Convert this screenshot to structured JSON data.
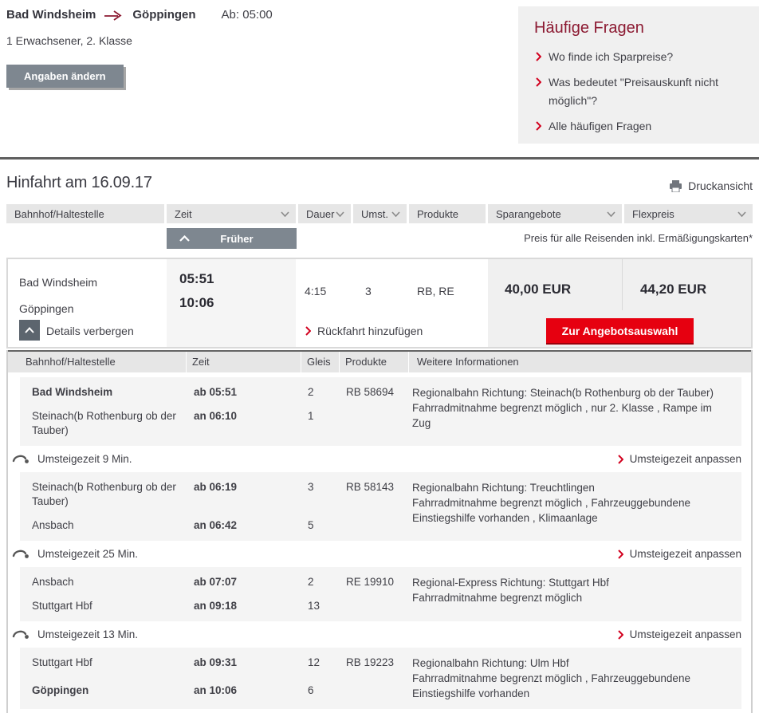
{
  "trip_header": {
    "from": "Bad Windsheim",
    "to": "Göppingen",
    "departure": "Ab: 05:00",
    "passengers": "1 Erwachsener, 2. Klasse",
    "change_button": "Angaben ändern"
  },
  "faq": {
    "title": "Häufige Fragen",
    "items": [
      {
        "label": "Wo finde ich Sparpreise?"
      },
      {
        "label": "Was bedeutet \"Preisauskunft nicht möglich\"?"
      },
      {
        "label": "Alle häufigen Fragen"
      }
    ]
  },
  "results": {
    "title": "Hinfahrt am 16.09.17",
    "print_label": "Druckansicht",
    "filters": [
      {
        "label": "Bahnhof/Haltestelle"
      },
      {
        "label": "Zeit"
      },
      {
        "label": "Dauer"
      },
      {
        "label": "Umst."
      },
      {
        "label": "Produkte"
      },
      {
        "label": "Sparangebote"
      },
      {
        "label": "Flexpreis"
      }
    ],
    "earlier_button": "Früher",
    "price_note": "Preis für alle Reisenden inkl. Ermäßigungskarten*",
    "connection": {
      "from": "Bad Windsheim",
      "to": "Göppingen",
      "departure_time": "05:51",
      "arrival_time": "10:06",
      "duration": "4:15",
      "changes": "3",
      "products": "RB, RE",
      "saver_price": "40,00 EUR",
      "flex_price": "44,20 EUR",
      "details_toggle": "Details verbergen",
      "return_link": "Rückfahrt hinzufügen",
      "offer_button": "Zur Angebotsauswahl"
    }
  },
  "details": {
    "columns": {
      "station": "Bahnhof/Haltestelle",
      "time": "Zeit",
      "platform": "Gleis",
      "products": "Produkte",
      "info": "Weitere Informationen"
    },
    "legs": [
      {
        "from": "Bad Windsheim",
        "dep": "ab 05:51",
        "dep_platform": "2",
        "to": "Steinach(b Rothenburg ob der Tauber)",
        "arr": "an 06:10",
        "arr_platform": "1",
        "train": "RB 58694",
        "direction": "Regionalbahn Richtung: Steinach(b Rothenburg ob der Tauber)",
        "amenities": "Fahrradmitnahme begrenzt möglich , nur 2. Klasse , Rampe im Zug"
      },
      {
        "from": "Steinach(b Rothenburg ob der Tauber)",
        "dep": "ab 06:19",
        "dep_platform": "3",
        "to": "Ansbach",
        "arr": "an 06:42",
        "arr_platform": "5",
        "train": "RB 58143",
        "direction": "Regionalbahn Richtung: Treuchtlingen",
        "amenities": "Fahrradmitnahme begrenzt möglich , Fahrzeuggebundene Einstiegshilfe vorhanden , Klimaanlage"
      },
      {
        "from": "Ansbach",
        "dep": "ab 07:07",
        "dep_platform": "2",
        "to": "Stuttgart Hbf",
        "arr": "an 09:18",
        "arr_platform": "13",
        "train": "RE 19910",
        "direction": "Regional-Express Richtung: Stuttgart Hbf",
        "amenities": "Fahrradmitnahme begrenzt möglich"
      },
      {
        "from": "Stuttgart Hbf",
        "dep": "ab 09:31",
        "dep_platform": "12",
        "to": "Göppingen",
        "arr": "an 10:06",
        "arr_platform": "6",
        "train": "RB 19223",
        "direction": "Regionalbahn Richtung: Ulm Hbf",
        "amenities": "Fahrradmitnahme begrenzt möglich , Fahrzeuggebundene Einstiegshilfe vorhanden"
      }
    ],
    "transfers": [
      {
        "label": "Umsteigezeit 9 Min.",
        "link": "Umsteigezeit anpassen"
      },
      {
        "label": "Umsteigezeit 25 Min.",
        "link": "Umsteigezeit anpassen"
      },
      {
        "label": "Umsteigezeit 13 Min.",
        "link": "Umsteigezeit anpassen"
      }
    ]
  },
  "colors": {
    "db_red": "#e60010",
    "maroon": "#8c1a32",
    "chevron_red": "#d2001e",
    "gray_button": "#7e8790"
  }
}
